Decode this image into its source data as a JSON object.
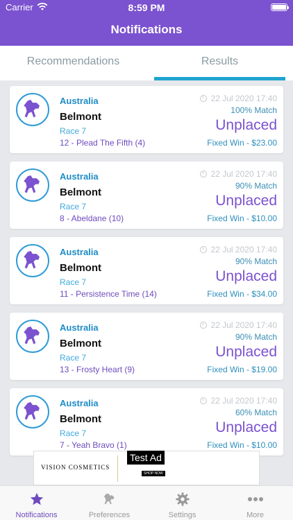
{
  "status_bar": {
    "carrier": "Carrier",
    "time": "8:59 PM",
    "battery_level": 1.0
  },
  "header": {
    "title": "Notifications"
  },
  "tabs": [
    {
      "label": "Recommendations",
      "selected": false
    },
    {
      "label": "Results",
      "selected": true
    }
  ],
  "notifications": [
    {
      "country": "Australia",
      "venue": "Belmont",
      "race": "Race 7",
      "runner": "12 - Plead The Fifth (4)",
      "datetime": "22 Jul 2020 17:40",
      "match": "100% Match",
      "result": "Unplaced",
      "payout": "Fixed Win - $23.00"
    },
    {
      "country": "Australia",
      "venue": "Belmont",
      "race": "Race 7",
      "runner": "8 - Abeldane (10)",
      "datetime": "22 Jul 2020 17:40",
      "match": "90% Match",
      "result": "Unplaced",
      "payout": "Fixed Win - $10.00"
    },
    {
      "country": "Australia",
      "venue": "Belmont",
      "race": "Race 7",
      "runner": "11 - Persistence Time (14)",
      "datetime": "22 Jul 2020 17:40",
      "match": "90% Match",
      "result": "Unplaced",
      "payout": "Fixed Win - $34.00"
    },
    {
      "country": "Australia",
      "venue": "Belmont",
      "race": "Race 7",
      "runner": "13 - Frosty Heart (9)",
      "datetime": "22 Jul 2020 17:40",
      "match": "90% Match",
      "result": "Unplaced",
      "payout": "Fixed Win - $19.00"
    },
    {
      "country": "Australia",
      "venue": "Belmont",
      "race": "Race 7",
      "runner": "7 - Yeah Bravo (1)",
      "datetime": "22 Jul 2020 17:40",
      "match": "60% Match",
      "result": "Unplaced",
      "payout": "Fixed Win - $10.00"
    }
  ],
  "ad": {
    "label": "Test Ad",
    "brand": "VISION COSMETICS",
    "cta": "SHOP NOW"
  },
  "tab_bar": [
    {
      "label": "Notifications",
      "icon": "star-icon",
      "active": true
    },
    {
      "label": "Preferences",
      "icon": "horse-icon",
      "active": false
    },
    {
      "label": "Settings",
      "icon": "gear-icon",
      "active": false
    },
    {
      "label": "More",
      "icon": "more-icon",
      "active": false
    }
  ],
  "colors": {
    "brand_purple": "#7b52cf",
    "accent_blue": "#1fa3d1"
  }
}
